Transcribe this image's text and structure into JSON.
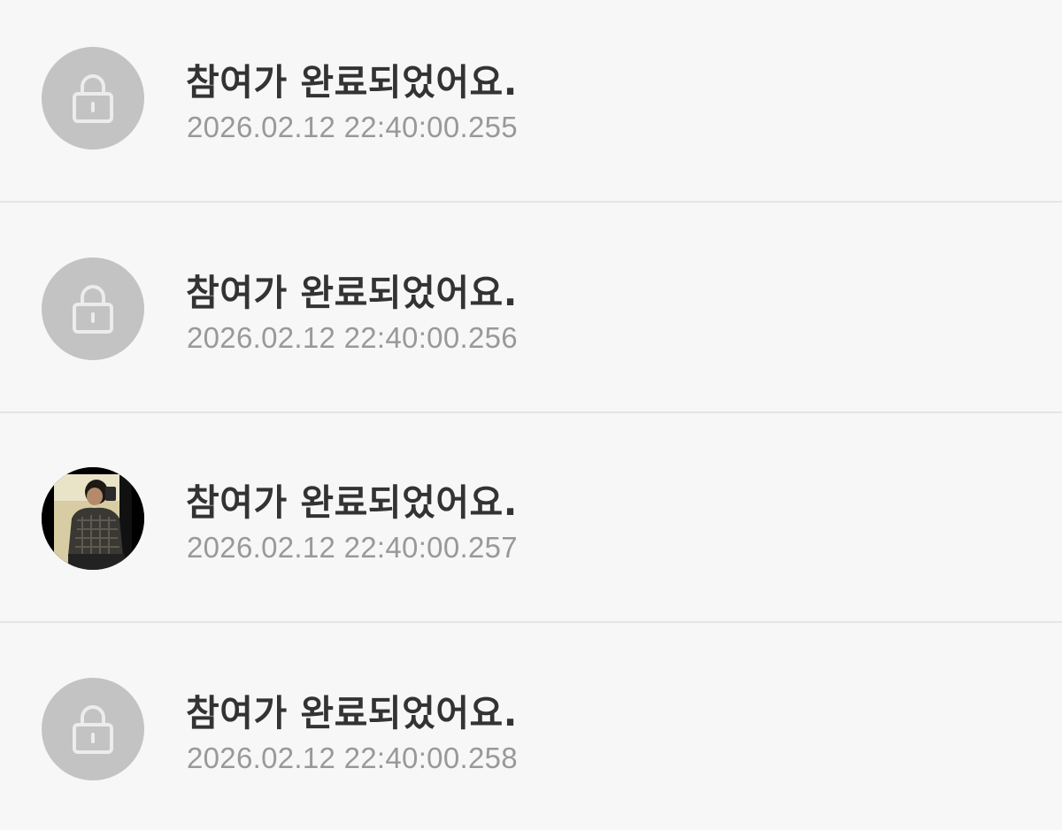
{
  "notifications": [
    {
      "message": "참여가 완료되었어요.",
      "timestamp": "2026.02.12 22:40:00.255",
      "avatar": "lock-icon"
    },
    {
      "message": "참여가 완료되었어요.",
      "timestamp": "2026.02.12 22:40:00.256",
      "avatar": "lock-icon"
    },
    {
      "message": "참여가 완료되었어요.",
      "timestamp": "2026.02.12 22:40:00.257",
      "avatar": "user-photo"
    },
    {
      "message": "참여가 완료되었어요.",
      "timestamp": "2026.02.12 22:40:00.258",
      "avatar": "lock-icon"
    }
  ],
  "colors": {
    "background": "#f7f7f7",
    "divider": "#e4e4e4",
    "avatar_placeholder": "#c3c3c3",
    "title_text": "#333333",
    "time_text": "#999999"
  }
}
